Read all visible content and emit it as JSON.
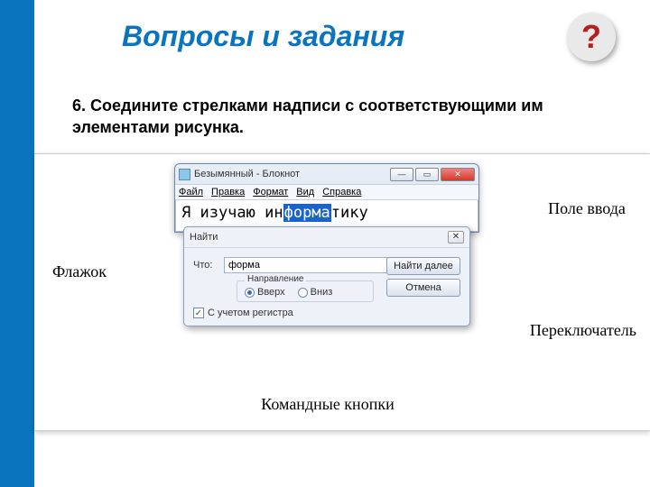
{
  "title": "Вопросы и задания",
  "badge": "?",
  "task": "6. Соедините стрелками надписи с соответствующими им элементами рисунка.",
  "labels": {
    "flag": "Флажок",
    "input": "Поле ввода",
    "switch": "Переключатель",
    "buttons": "Командные кнопки"
  },
  "notepad": {
    "title": "Безымянный - Блокнот",
    "menu": [
      "Файл",
      "Правка",
      "Формат",
      "Вид",
      "Справка"
    ],
    "text_before": "Я изучаю ин",
    "text_hl": "форма",
    "text_after": "тику",
    "winbtn_close": "✕"
  },
  "find": {
    "title": "Найти",
    "what_label": "Что:",
    "what_value": "форма",
    "btn_next": "Найти далее",
    "btn_cancel": "Отмена",
    "direction_legend": "Направление",
    "dir_up": "Вверх",
    "dir_down": "Вниз",
    "case_label": "С учетом регистра",
    "close": "✕",
    "check_mark": "✓"
  }
}
